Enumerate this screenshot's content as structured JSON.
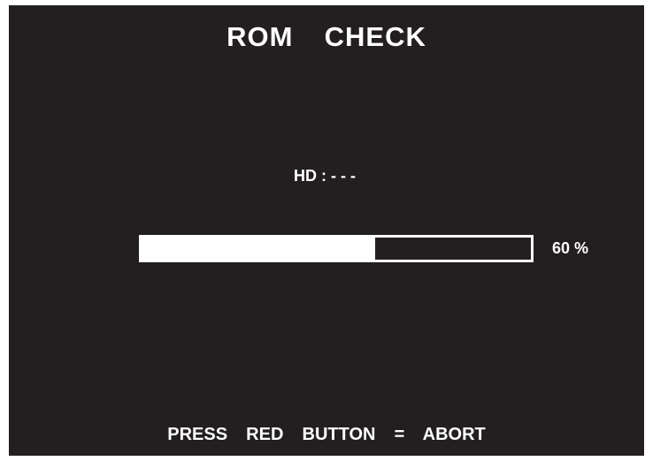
{
  "screen": {
    "title": "ROM  CHECK",
    "hd_status": "HD : - - -",
    "progress": {
      "value": 60,
      "label": "60 %"
    },
    "footer": "PRESS  RED  BUTTON  =  ABORT",
    "colors": {
      "background": "#231f20",
      "foreground": "#ffffff"
    }
  }
}
